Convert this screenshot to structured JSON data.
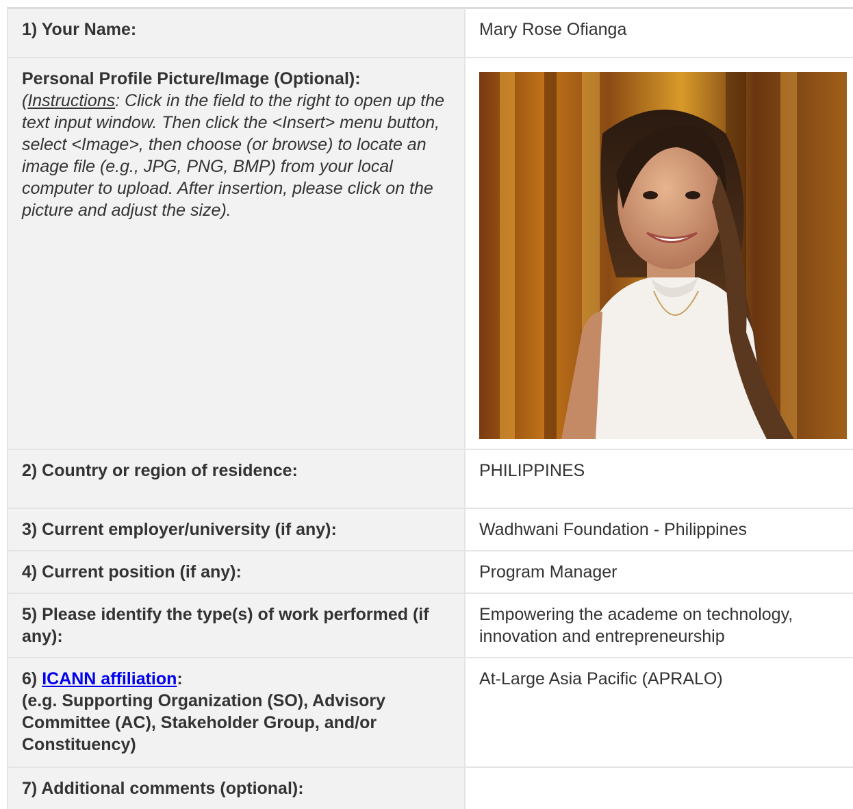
{
  "rows": {
    "name": {
      "label": "1) Your Name:",
      "value": "Mary Rose Ofianga"
    },
    "photo": {
      "label": "Personal Profile Picture/Image (Optional):",
      "instr_open": "(",
      "instr_word": "Instructions",
      "instr_rest": ": Click in the field to the right to open up the text input window. Then click the <Insert> menu button, select <Image>, then choose (or browse) to locate an image file (e.g., JPG, PNG, BMP) from your local computer to upload. After insertion, please click on the picture and adjust the size)."
    },
    "country": {
      "label": "2) Country or region of residence:",
      "value": "PHILIPPINES"
    },
    "employer": {
      "label": "3) Current employer/university (if any):",
      "value": "Wadhwani Foundation - Philippines"
    },
    "position": {
      "label": "4) Current position (if any):",
      "value": "Program Manager"
    },
    "work": {
      "label": "5) Please identify the type(s) of work performed (if any):",
      "value": "Empowering the academe on technology, innovation and entrepreneurship"
    },
    "icann": {
      "prefix": "6) ",
      "link": "ICANN affiliation",
      "colon": ":",
      "detail": "(e.g. Supporting Organization (SO), Advisory Committee (AC), Stakeholder Group, and/or Constituency)",
      "value": "At-Large Asia Pacific (APRALO)"
    },
    "comments": {
      "label": "7) Additional comments (optional):",
      "value": ""
    }
  },
  "colors": {
    "label_bg": "#f2f2f2",
    "border": "#e4e4e4",
    "link": "#0000ee",
    "text": "#333333"
  }
}
